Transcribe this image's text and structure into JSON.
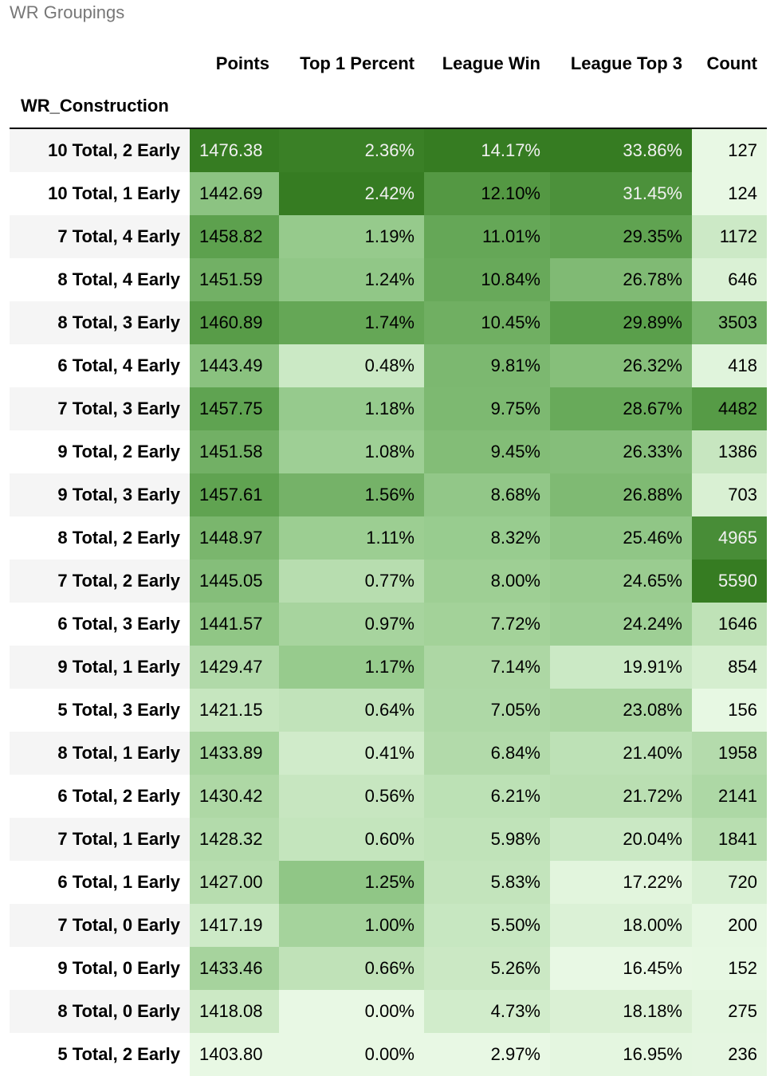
{
  "title": "WR Groupings",
  "index_name": "WR_Construction",
  "columns": [
    "Points",
    "Top 1 Percent",
    "League Win",
    "League Top 3",
    "Count"
  ],
  "colormap": {
    "light": "#e8f8e4",
    "dark": "#367c22"
  },
  "rows": [
    {
      "label": "10 Total, 2 Early",
      "points": "1476.38",
      "top1": "2.36%",
      "win": "14.17%",
      "top3": "33.86%",
      "count": "127"
    },
    {
      "label": "10 Total, 1 Early",
      "points": "1442.69",
      "top1": "2.42%",
      "win": "12.10%",
      "top3": "31.45%",
      "count": "124"
    },
    {
      "label": "7 Total, 4 Early",
      "points": "1458.82",
      "top1": "1.19%",
      "win": "11.01%",
      "top3": "29.35%",
      "count": "1172"
    },
    {
      "label": "8 Total, 4 Early",
      "points": "1451.59",
      "top1": "1.24%",
      "win": "10.84%",
      "top3": "26.78%",
      "count": "646"
    },
    {
      "label": "8 Total, 3 Early",
      "points": "1460.89",
      "top1": "1.74%",
      "win": "10.45%",
      "top3": "29.89%",
      "count": "3503"
    },
    {
      "label": "6 Total, 4 Early",
      "points": "1443.49",
      "top1": "0.48%",
      "win": "9.81%",
      "top3": "26.32%",
      "count": "418"
    },
    {
      "label": "7 Total, 3 Early",
      "points": "1457.75",
      "top1": "1.18%",
      "win": "9.75%",
      "top3": "28.67%",
      "count": "4482"
    },
    {
      "label": "9 Total, 2 Early",
      "points": "1451.58",
      "top1": "1.08%",
      "win": "9.45%",
      "top3": "26.33%",
      "count": "1386"
    },
    {
      "label": "9 Total, 3 Early",
      "points": "1457.61",
      "top1": "1.56%",
      "win": "8.68%",
      "top3": "26.88%",
      "count": "703"
    },
    {
      "label": "8 Total, 2 Early",
      "points": "1448.97",
      "top1": "1.11%",
      "win": "8.32%",
      "top3": "25.46%",
      "count": "4965"
    },
    {
      "label": "7 Total, 2 Early",
      "points": "1445.05",
      "top1": "0.77%",
      "win": "8.00%",
      "top3": "24.65%",
      "count": "5590"
    },
    {
      "label": "6 Total, 3 Early",
      "points": "1441.57",
      "top1": "0.97%",
      "win": "7.72%",
      "top3": "24.24%",
      "count": "1646"
    },
    {
      "label": "9 Total, 1 Early",
      "points": "1429.47",
      "top1": "1.17%",
      "win": "7.14%",
      "top3": "19.91%",
      "count": "854"
    },
    {
      "label": "5 Total, 3 Early",
      "points": "1421.15",
      "top1": "0.64%",
      "win": "7.05%",
      "top3": "23.08%",
      "count": "156"
    },
    {
      "label": "8 Total, 1 Early",
      "points": "1433.89",
      "top1": "0.41%",
      "win": "6.84%",
      "top3": "21.40%",
      "count": "1958"
    },
    {
      "label": "6 Total, 2 Early",
      "points": "1430.42",
      "top1": "0.56%",
      "win": "6.21%",
      "top3": "21.72%",
      "count": "2141"
    },
    {
      "label": "7 Total, 1 Early",
      "points": "1428.32",
      "top1": "0.60%",
      "win": "5.98%",
      "top3": "20.04%",
      "count": "1841"
    },
    {
      "label": "6 Total, 1 Early",
      "points": "1427.00",
      "top1": "1.25%",
      "win": "5.83%",
      "top3": "17.22%",
      "count": "720"
    },
    {
      "label": "7 Total, 0 Early",
      "points": "1417.19",
      "top1": "1.00%",
      "win": "5.50%",
      "top3": "18.00%",
      "count": "200"
    },
    {
      "label": "9 Total, 0 Early",
      "points": "1433.46",
      "top1": "0.66%",
      "win": "5.26%",
      "top3": "16.45%",
      "count": "152"
    },
    {
      "label": "8 Total, 0 Early",
      "points": "1418.08",
      "top1": "0.00%",
      "win": "4.73%",
      "top3": "18.18%",
      "count": "275"
    },
    {
      "label": "5 Total, 2 Early",
      "points": "1403.80",
      "top1": "0.00%",
      "win": "2.97%",
      "top3": "16.95%",
      "count": "236"
    }
  ]
}
